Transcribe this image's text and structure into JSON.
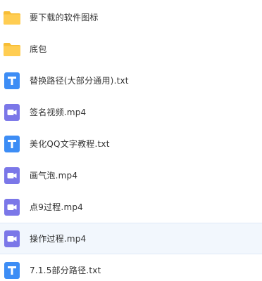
{
  "colors": {
    "folder": "#ffcd52",
    "folder_tab": "#f7bd35",
    "txt_icon": "#3d8df5",
    "video_icon": "#7b77e8",
    "selected_row": "#f2f7fd",
    "text": "#333333"
  },
  "files": [
    {
      "name": "要下载的软件图标",
      "icon": "folder-icon",
      "selected": false
    },
    {
      "name": "底包",
      "icon": "folder-icon",
      "selected": false
    },
    {
      "name": "替换路径(大部分通用).txt",
      "icon": "text-file-icon",
      "selected": false
    },
    {
      "name": "签名视频.mp4",
      "icon": "video-file-icon",
      "selected": false
    },
    {
      "name": "美化QQ文字教程.txt",
      "icon": "text-file-icon",
      "selected": false
    },
    {
      "name": "画气泡.mp4",
      "icon": "video-file-icon",
      "selected": false
    },
    {
      "name": "点9过程.mp4",
      "icon": "video-file-icon",
      "selected": false
    },
    {
      "name": "操作过程.mp4",
      "icon": "video-file-icon",
      "selected": true
    },
    {
      "name": "7.1.5部分路径.txt",
      "icon": "text-file-icon",
      "selected": false
    }
  ]
}
